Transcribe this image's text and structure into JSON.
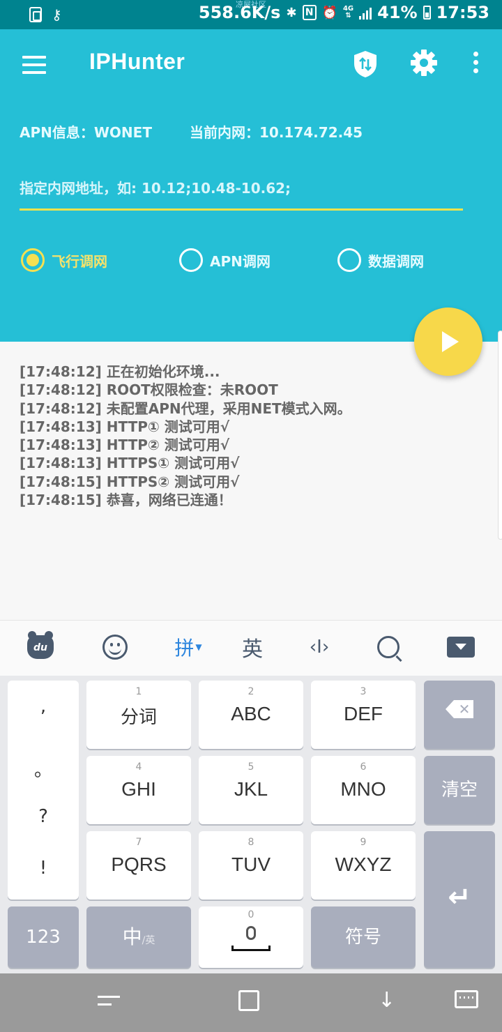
{
  "status_bar": {
    "net_speed": "558.6K/s",
    "network": "4G",
    "battery": "41%",
    "time": "17:53",
    "watermark": "凉屋社区",
    "icons": [
      "document-icon",
      "key-icon",
      "bluetooth-icon",
      "nfc-icon",
      "alarm-icon",
      "signal-icon",
      "battery-icon"
    ]
  },
  "app": {
    "title": "IPHunter",
    "toolbar_icons": [
      "shield-icon",
      "gear-icon",
      "more-vert-icon"
    ]
  },
  "info": {
    "apn": "APN信息：WONET",
    "current_ip": "当前内网：10.174.72.45"
  },
  "ip_input": {
    "value": "",
    "placeholder": "指定内网地址，如: 10.12;10.48-10.62;"
  },
  "modes": {
    "selected": "飞行调网",
    "options": [
      "飞行调网",
      "APN调网",
      "数据调网"
    ]
  },
  "log": [
    "[17:48:12] 正在初始化环境...",
    "[17:48:12] ROOT权限检查：未ROOT",
    "[17:48:12] 未配置APN代理，采用NET模式入网。",
    "[17:48:13] HTTP①   测试可用√",
    "[17:48:13] HTTP②   测试可用√",
    "[17:48:13] HTTPS① 测试可用√",
    "[17:48:15] HTTPS② 测试可用√",
    "[17:48:15] 恭喜，网络已连通！"
  ],
  "keyboard": {
    "toolbar": {
      "bear_label": "du",
      "pinyin": "拼",
      "english": "英",
      "cursor": "‹I›"
    },
    "punct": [
      ",",
      "。",
      "?",
      "!"
    ],
    "keys": [
      {
        "num": "1",
        "label": "分词"
      },
      {
        "num": "2",
        "label": "ABC"
      },
      {
        "num": "3",
        "label": "DEF"
      },
      {
        "num": "4",
        "label": "GHI"
      },
      {
        "num": "5",
        "label": "JKL"
      },
      {
        "num": "6",
        "label": "MNO"
      },
      {
        "num": "7",
        "label": "PQRS"
      },
      {
        "num": "8",
        "label": "TUV"
      },
      {
        "num": "9",
        "label": "WXYZ"
      }
    ],
    "clear": "清空",
    "num_switch": "123",
    "lang_main": "中",
    "lang_sub": "/英",
    "space_num": "0",
    "symbols": "符号",
    "backspace_glyph": "✕",
    "enter_glyph": "↵"
  },
  "nav": {
    "back_glyph": "↓"
  }
}
